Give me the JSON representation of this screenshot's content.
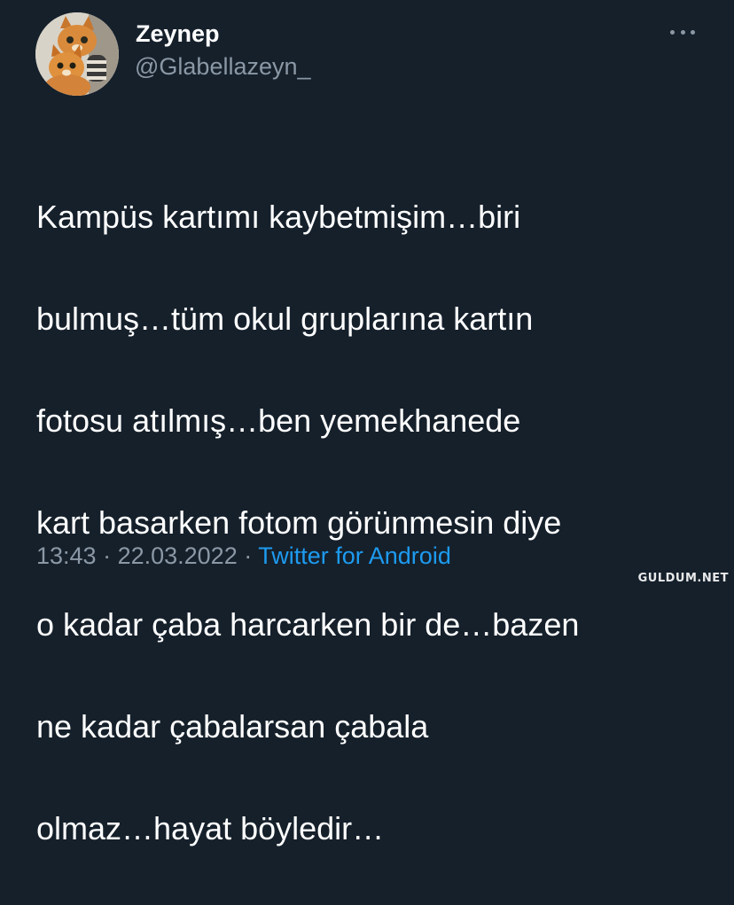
{
  "author": {
    "name": "Zeynep",
    "handle": "@Glabellazeyn_",
    "avatar_icon": "cats-avatar"
  },
  "more_icon": "more-options-icon",
  "tweet": {
    "text_lines": [
      "Kampüs kartımı kaybetmişim…biri",
      "bulmuş…tüm okul gruplarına kartın",
      "fotosu atılmış…ben yemekhanede",
      "kart basarken fotom görünmesin diye",
      "o kadar çaba harcarken bir de…bazen",
      "ne kadar çabalarsan çabala",
      "olmaz…hayat böyledir…"
    ],
    "time": "13:43",
    "separator": " · ",
    "date": "22.03.2022",
    "source": "Twitter for Android"
  },
  "watermark": "GULDUM.NET",
  "colors": {
    "background": "#15202b",
    "text": "#ffffff",
    "muted": "#8b98a5",
    "link": "#1d9bf0"
  }
}
